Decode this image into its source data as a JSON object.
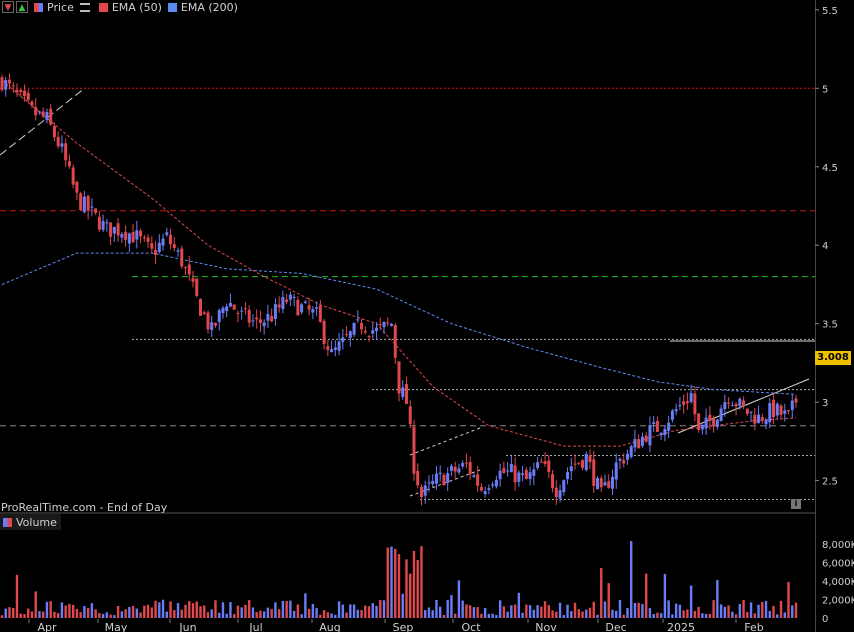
{
  "legend": {
    "price": "Price",
    "ema50": "EMA (50)",
    "ema200": "EMA (200)",
    "volume": "Volume"
  },
  "watermark": "ProRealTime.com - End of Day",
  "last_price": "3.008",
  "colors": {
    "up": "#6b7df6",
    "down": "#e0484d",
    "ema50": "#e0484d",
    "ema200": "#5b8cf0",
    "last": "#f0c000"
  },
  "chart_data": {
    "type": "candlestick",
    "price_axis": {
      "ylim": [
        2.3,
        5.55
      ],
      "ticks": [
        "2.5",
        "3",
        "3.5",
        "4",
        "4.5",
        "5",
        "5.5"
      ]
    },
    "volume_axis": {
      "ylim": [
        0,
        9500
      ],
      "ticks": [
        "0",
        "2,000K",
        "4,000K",
        "6,000K",
        "8,000K"
      ]
    },
    "months": [
      "Apr",
      "May",
      "Jun",
      "Jul",
      "Aug",
      "Sep",
      "Oct",
      "Nov",
      "Dec",
      "2025",
      "Feb"
    ],
    "price_keypoints": [
      [
        0,
        5.05
      ],
      [
        4,
        4.95
      ],
      [
        8,
        4.85
      ],
      [
        12,
        4.8
      ],
      [
        16,
        4.6
      ],
      [
        20,
        4.3
      ],
      [
        24,
        4.2
      ],
      [
        28,
        4.1
      ],
      [
        32,
        4.1
      ],
      [
        36,
        4.05
      ],
      [
        40,
        3.95
      ],
      [
        44,
        4.05
      ],
      [
        48,
        3.9
      ],
      [
        52,
        3.65
      ],
      [
        56,
        3.45
      ],
      [
        60,
        3.65
      ],
      [
        64,
        3.55
      ],
      [
        68,
        3.5
      ],
      [
        72,
        3.55
      ],
      [
        76,
        3.65
      ],
      [
        80,
        3.6
      ],
      [
        84,
        3.55
      ],
      [
        88,
        3.3
      ],
      [
        92,
        3.4
      ],
      [
        96,
        3.5
      ],
      [
        100,
        3.45
      ],
      [
        104,
        3.5
      ],
      [
        106,
        3.1
      ],
      [
        108,
        3.0
      ],
      [
        110,
        2.6
      ],
      [
        112,
        2.4
      ],
      [
        116,
        2.5
      ],
      [
        120,
        2.55
      ],
      [
        124,
        2.6
      ],
      [
        128,
        2.45
      ],
      [
        132,
        2.55
      ],
      [
        136,
        2.55
      ],
      [
        140,
        2.5
      ],
      [
        144,
        2.6
      ],
      [
        148,
        2.45
      ],
      [
        152,
        2.6
      ],
      [
        156,
        2.65
      ],
      [
        160,
        2.4
      ],
      [
        164,
        2.6
      ],
      [
        168,
        2.7
      ],
      [
        172,
        2.8
      ],
      [
        176,
        2.85
      ],
      [
        180,
        2.95
      ],
      [
        184,
        3.05
      ],
      [
        186,
        2.8
      ],
      [
        190,
        2.9
      ],
      [
        194,
        3.05
      ],
      [
        198,
        2.95
      ],
      [
        202,
        2.9
      ],
      [
        206,
        2.95
      ],
      [
        210,
        2.9
      ],
      [
        212,
        3.01
      ]
    ],
    "ema50_points": [
      [
        0,
        5.05
      ],
      [
        20,
        4.65
      ],
      [
        40,
        4.3
      ],
      [
        55,
        4.0
      ],
      [
        70,
        3.8
      ],
      [
        85,
        3.62
      ],
      [
        100,
        3.5
      ],
      [
        115,
        3.1
      ],
      [
        130,
        2.85
      ],
      [
        150,
        2.72
      ],
      [
        165,
        2.72
      ],
      [
        180,
        2.82
      ],
      [
        200,
        2.88
      ],
      [
        212,
        2.9
      ]
    ],
    "ema200_points": [
      [
        0,
        3.75
      ],
      [
        20,
        3.95
      ],
      [
        40,
        3.95
      ],
      [
        60,
        3.85
      ],
      [
        80,
        3.82
      ],
      [
        100,
        3.72
      ],
      [
        120,
        3.5
      ],
      [
        140,
        3.35
      ],
      [
        160,
        3.22
      ],
      [
        175,
        3.13
      ],
      [
        190,
        3.08
      ],
      [
        212,
        3.05
      ]
    ],
    "horizontal_levels": [
      {
        "value": 5.0,
        "color": "#d01818",
        "style": "dotted",
        "from": 0
      },
      {
        "value": 4.22,
        "color": "#c01818",
        "style": "dashed",
        "from": 0
      },
      {
        "value": 3.8,
        "color": "#20c020",
        "style": "dashed",
        "from": 132
      },
      {
        "value": 3.4,
        "color": "#aaaaaa",
        "style": "dotted",
        "from": 132
      },
      {
        "value": 3.08,
        "color": "#aaaaaa",
        "style": "dotted",
        "from": 372
      },
      {
        "value": 2.85,
        "color": "#888888",
        "style": "dashed",
        "from": 0
      },
      {
        "value": 2.66,
        "color": "#aaaaaa",
        "style": "dotted",
        "from": 506
      },
      {
        "value": 2.38,
        "color": "#aaaaaa",
        "style": "dotted",
        "from": 420
      }
    ]
  }
}
